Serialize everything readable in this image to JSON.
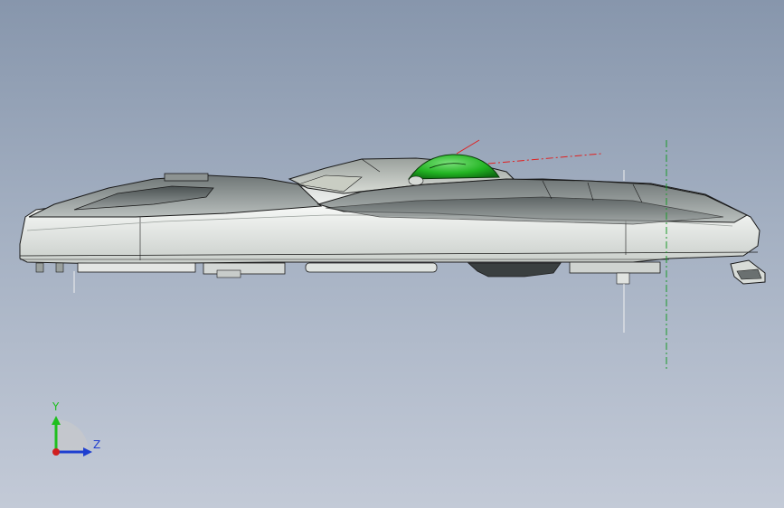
{
  "viewport": {
    "background_top": "#8796ac",
    "background_bottom": "#c3cad7"
  },
  "model": {
    "body_color": "#e9ecea",
    "edge_color": "#1a1a1a",
    "shade_color": "#5f6566",
    "dome_color": "#22b422",
    "dome_highlight": "#7be07b",
    "centerline_color": "#1a9a2a",
    "reference_color": "#e02020"
  },
  "triad": {
    "y_label": "Y",
    "z_label": "Z",
    "y_color": "#1fbf1f",
    "z_color": "#1f3fd0",
    "x_color": "#d01f1f"
  }
}
